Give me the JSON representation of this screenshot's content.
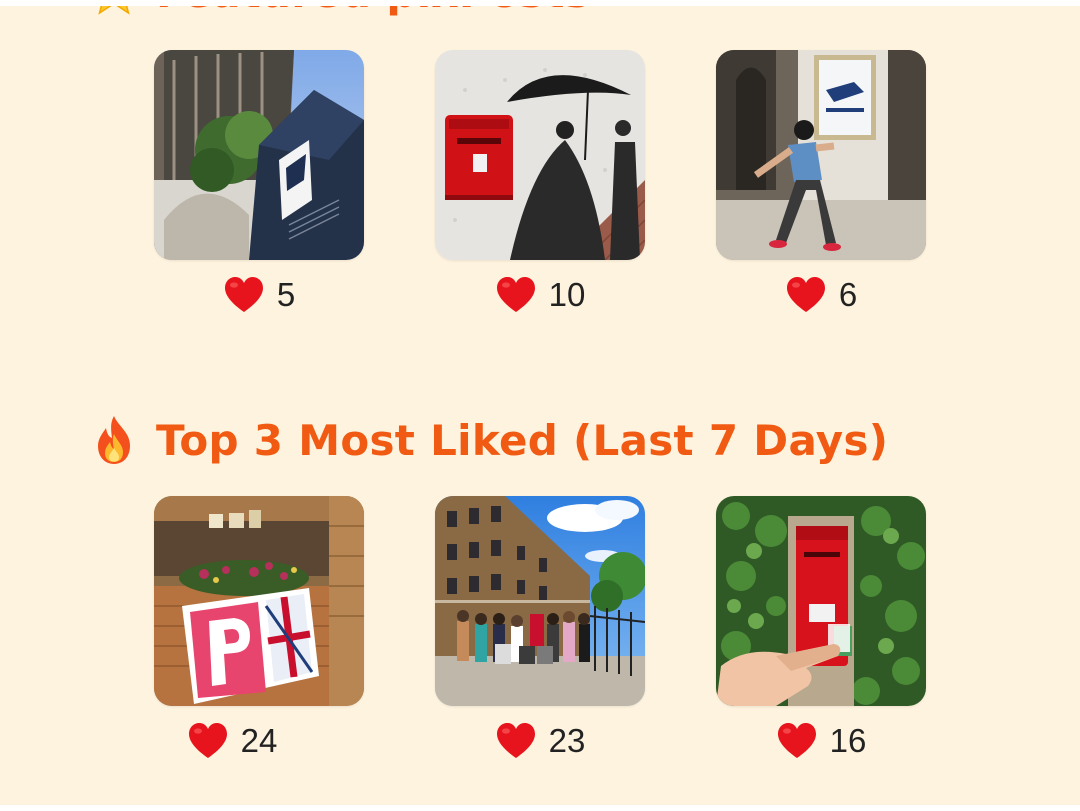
{
  "sections": [
    {
      "title": "Featured pixPosts",
      "icon": "star-icon",
      "posts": [
        {
          "image": "usps-mailbox-city-photo",
          "likes": "5"
        },
        {
          "image": "red-postbox-mural-photo",
          "likes": "10"
        },
        {
          "image": "man-posing-post-office-photo",
          "likes": "6"
        }
      ]
    },
    {
      "title": "Top 3 Most Liked (Last 7 Days)",
      "icon": "fire-icon",
      "posts": [
        {
          "image": "flowers-flag-stamp-photo",
          "likes": "24"
        },
        {
          "image": "group-street-postbox-photo",
          "likes": "23"
        },
        {
          "image": "red-wall-postbox-ivy-photo",
          "likes": "16"
        }
      ]
    }
  ],
  "colors": {
    "background": "#fef3de",
    "heading": "#f05a13",
    "heart": "#e8141d",
    "count_text": "#222222"
  }
}
